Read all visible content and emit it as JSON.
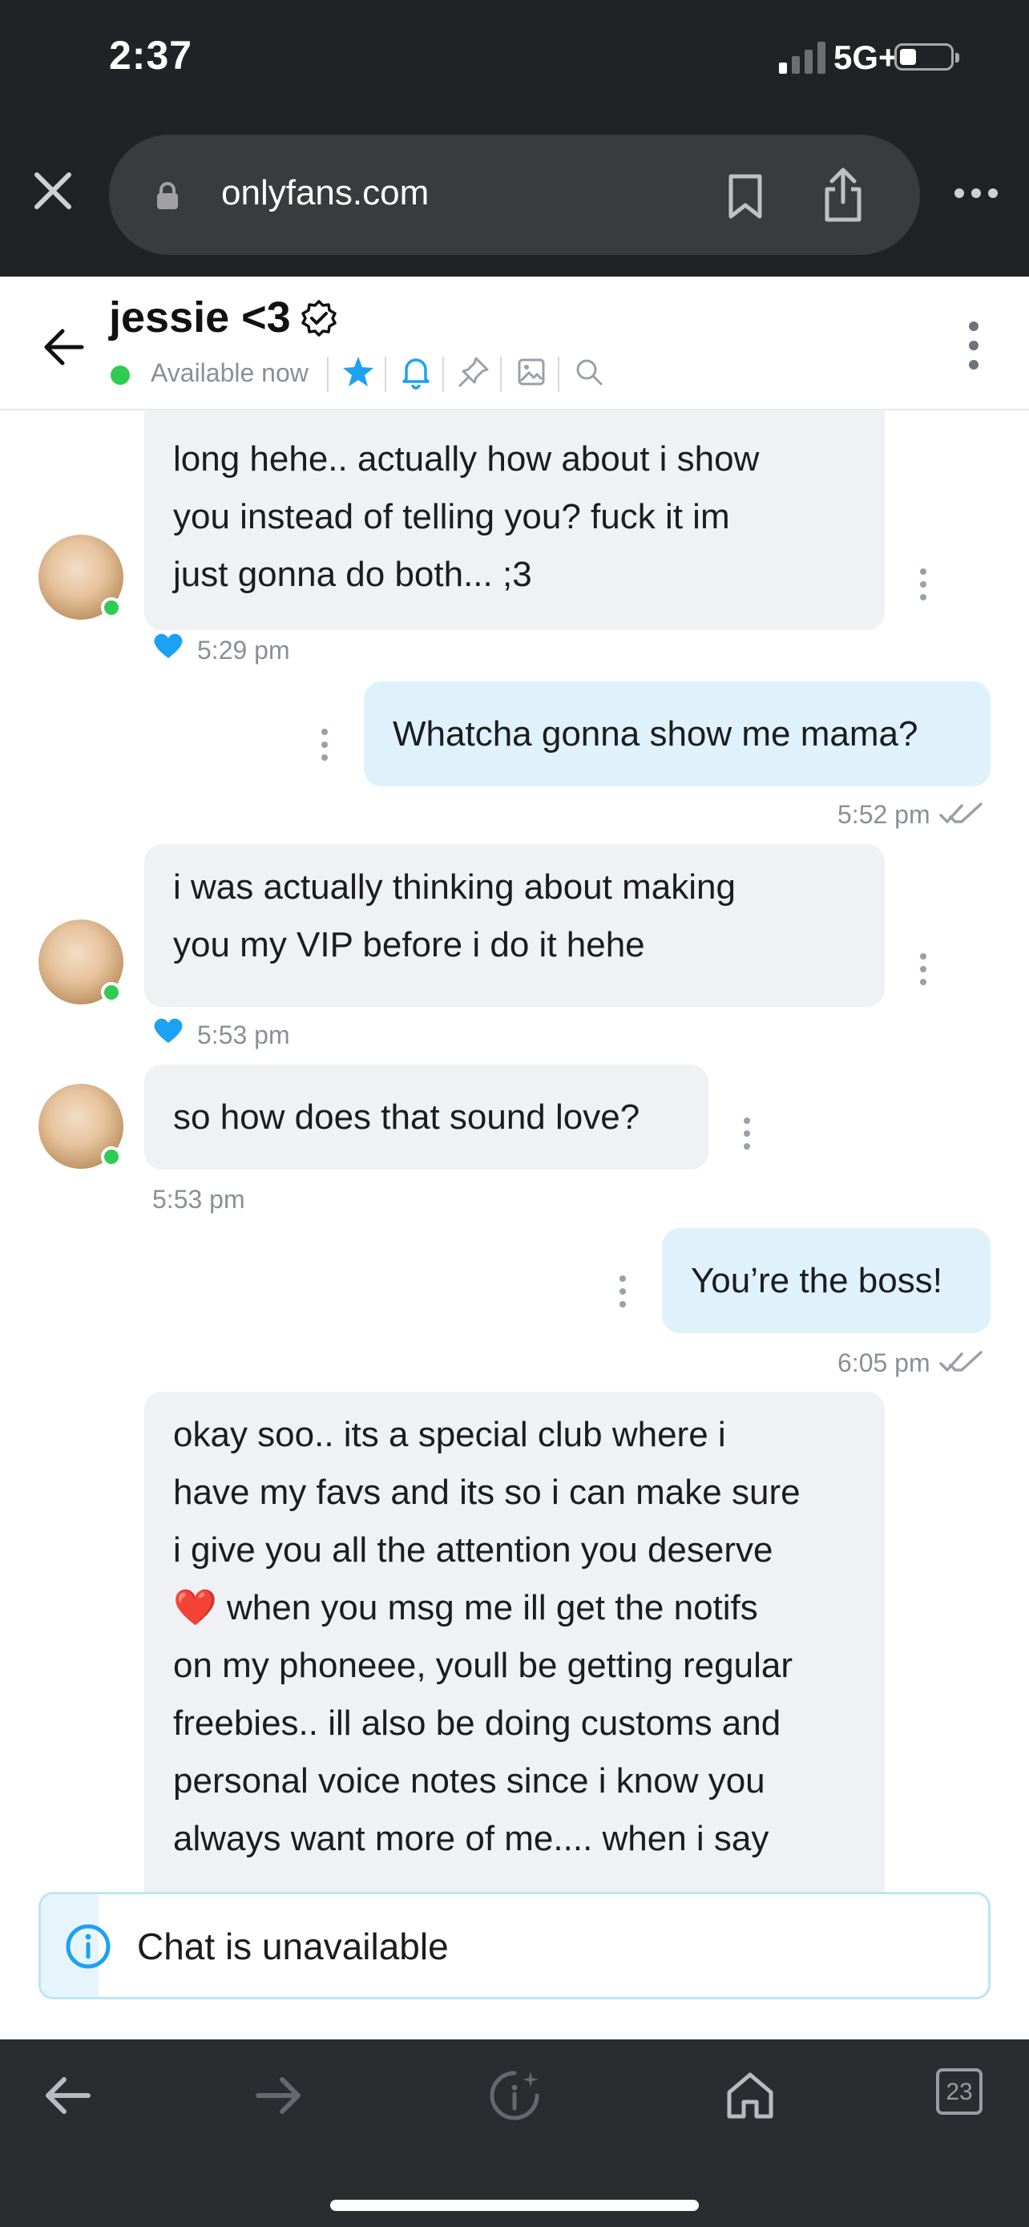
{
  "status_bar": {
    "time": "2:37",
    "network": "5G+"
  },
  "browser": {
    "url": "onlyfans.com",
    "tab_count": "23"
  },
  "chat_header": {
    "name": "jessie <3",
    "status": "Available now"
  },
  "messages": [
    {
      "side": "in",
      "text": "long hehe.. actually how about i show\nyou instead of telling you? fuck it im\njust gonna do both... ;3",
      "time": "5:29 pm",
      "liked": true
    },
    {
      "side": "out",
      "text": "Whatcha gonna show me mama?",
      "time": "5:52 pm"
    },
    {
      "side": "in",
      "text": "i was actually thinking about making\nyou my VIP before i do it hehe",
      "time": "5:53 pm",
      "liked": true
    },
    {
      "side": "in",
      "text": "so how does that sound love?",
      "time": "5:53 pm",
      "liked": false
    },
    {
      "side": "out",
      "text": "You’re the boss!",
      "time": "6:05 pm"
    },
    {
      "side": "in",
      "text": "okay soo.. its a special club where i\nhave my favs and its so i can make sure\ni give you all the attention you deserve\n❤️ when you msg me ill get the notifs\non my phoneee, youll be getting regular\nfreebies.. ill also be doing customs and\npersonal voice notes since i know you\nalways want more of me.... when i say"
    }
  ],
  "notice": {
    "text": "Chat is unavailable"
  },
  "colors": {
    "online": "#2ecc52",
    "accent": "#1da1f2",
    "incoming_bubble": "#f0f1f4",
    "outgoing_bubble": "#dff2fc"
  }
}
